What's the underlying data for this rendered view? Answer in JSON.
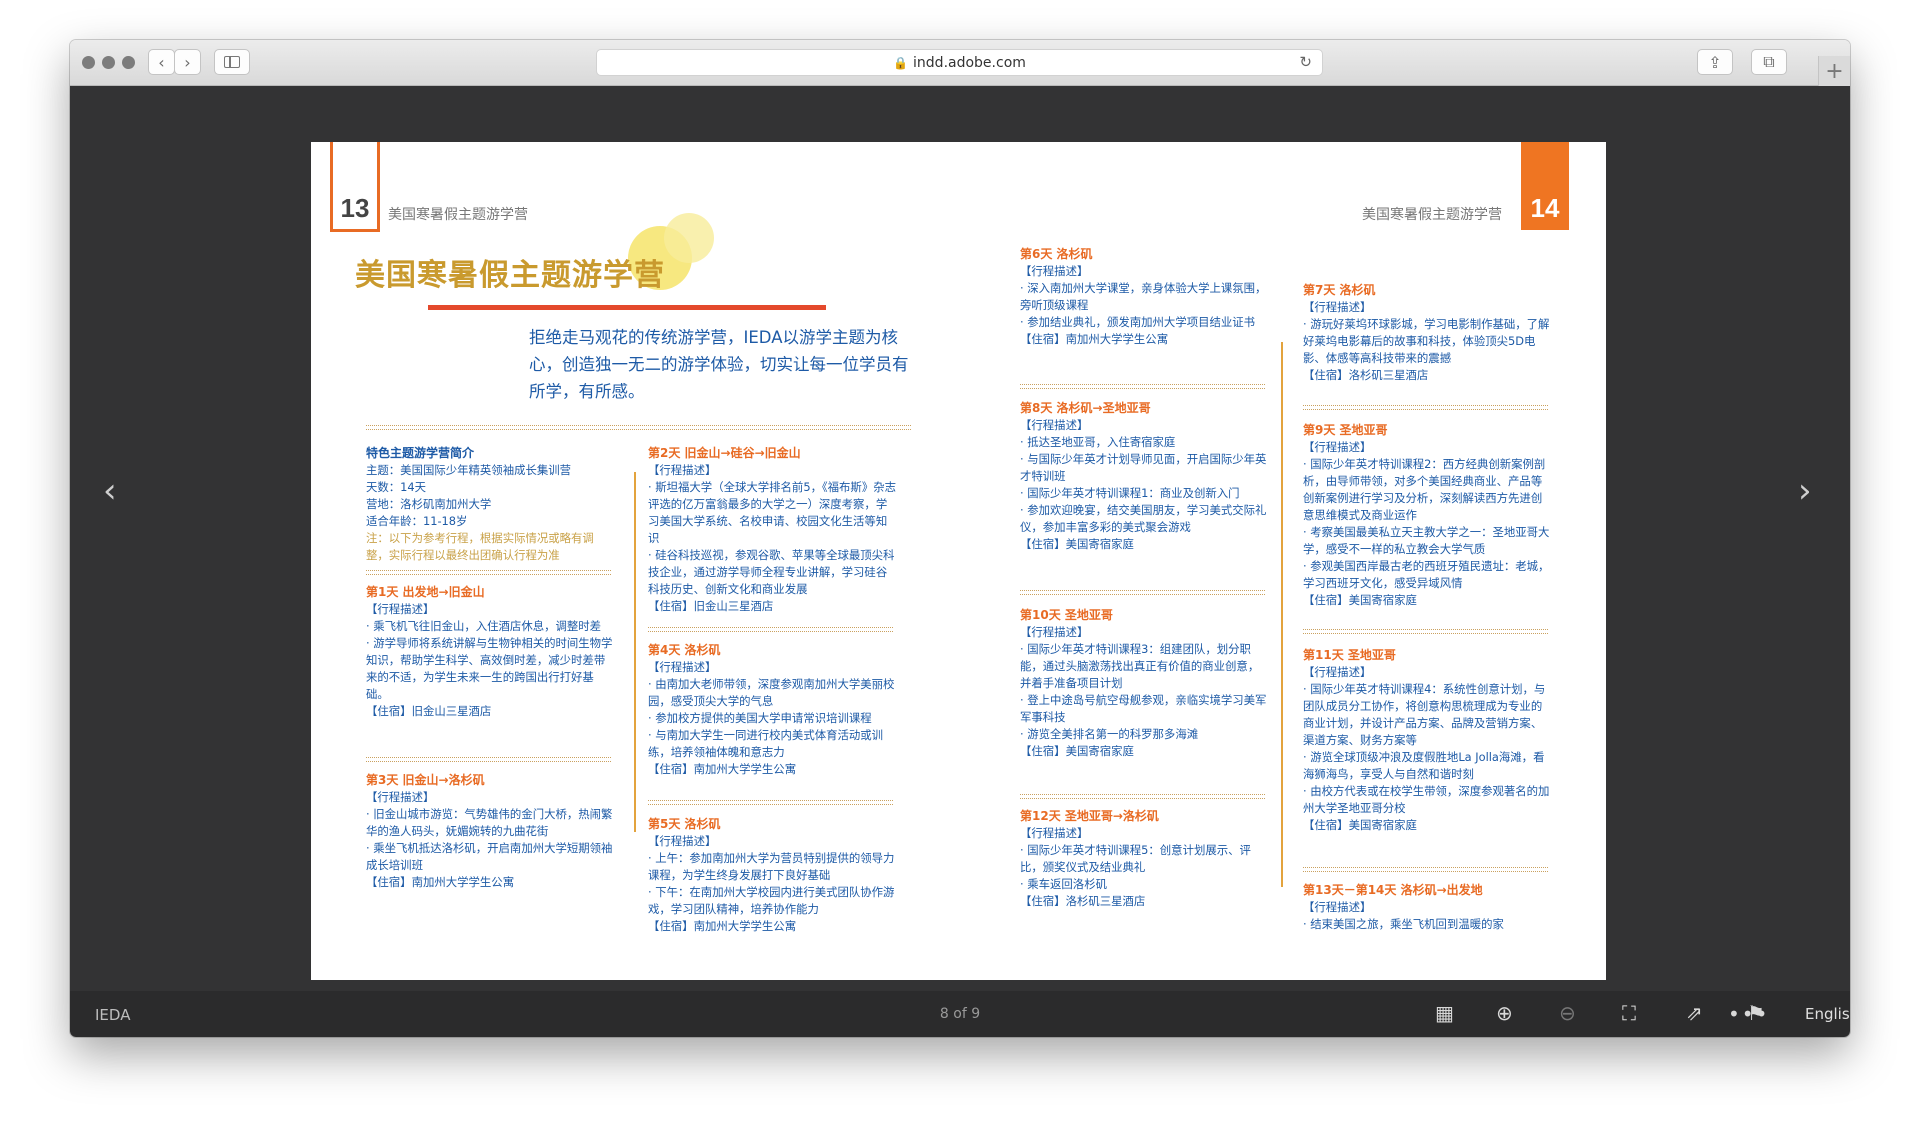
{
  "browser": {
    "url": "indd.adobe.com",
    "icons": [
      "back-icon",
      "forward-icon",
      "sidebar-icon",
      "lock-icon",
      "reload-icon",
      "share-icon",
      "tabs-icon",
      "new-tab-icon"
    ]
  },
  "viewer": {
    "doc_title": "IEDA",
    "page_indicator": "8 of 9",
    "language": "English",
    "colors": {
      "accent_orange": "#ef7522",
      "title_gold": "#c99a2e",
      "text_blue": "#1d5aa6",
      "red_bar": "#e4492c",
      "viewer_bg": "#333334"
    }
  },
  "doc": {
    "page_left": "13",
    "page_right": "14",
    "running_head_left": "美国寒暑假主题游学营",
    "running_head_right": "美国寒暑假主题游学营",
    "title": "美国寒暑假主题游学营",
    "intro": "拒绝走马观花的传统游学营，IEDA以游学主题为核心，创造独一无二的游学体验，切实让每一位学员有所学，有所感。",
    "summary": {
      "heading": "特色主题游学营简介",
      "lines": [
        "主题：美国国际少年精英领袖成长集训营",
        "天数：14天",
        "营地：洛杉矶南加州大学",
        "适合年龄：11-18岁"
      ],
      "note": "注：以下为参考行程，根据实际情况或略有调整，实际行程以最终出团确认行程为准"
    },
    "days": [
      {
        "heading": "第1天 出发地→旧金山",
        "lines": [
          "【行程描述】",
          "· 乘飞机飞往旧金山，入住酒店休息，调整时差",
          "· 游学导师将系统讲解与生物钟相关的时间生物学知识，帮助学生科学、高效倒时差，减少时差带来的不适，为学生未来一生的跨国出行打好基础。",
          "【住宿】旧金山三星酒店"
        ]
      },
      {
        "heading": "第3天 旧金山→洛杉矶",
        "lines": [
          "【行程描述】",
          "· 旧金山城市游览：气势雄伟的金门大桥，热闹繁华的渔人码头，妩媚婉转的九曲花街",
          "· 乘坐飞机抵达洛杉矶，开启南加州大学短期领袖成长培训班",
          "【住宿】南加州大学学生公寓"
        ]
      },
      {
        "heading": "第2天 旧金山→硅谷→旧金山",
        "lines": [
          "【行程描述】",
          "· 斯坦福大学（全球大学排名前5，《福布斯》杂志评选的亿万富翁最多的大学之一）深度考察，学习美国大学系统、名校申请、校园文化生活等知识",
          "· 硅谷科技巡视，参观谷歌、苹果等全球最顶尖科技企业，通过游学导师全程专业讲解，学习硅谷科技历史、创新文化和商业发展",
          "【住宿】旧金山三星酒店"
        ]
      },
      {
        "heading": "第4天 洛杉矶",
        "lines": [
          "【行程描述】",
          "· 由南加大老师带领，深度参观南加州大学美丽校园，感受顶尖大学的气息",
          "· 参加校方提供的美国大学申请常识培训课程",
          "· 与南加大学生一同进行校内美式体育活动或训练，培养领袖体魄和意志力",
          "【住宿】南加州大学学生公寓"
        ]
      },
      {
        "heading": "第5天 洛杉矶",
        "lines": [
          "【行程描述】",
          "· 上午：参加南加州大学为营员特别提供的领导力课程，为学生终身发展打下良好基础",
          "· 下午：在南加州大学校园内进行美式团队协作游戏，学习团队精神，培养协作能力",
          "【住宿】南加州大学学生公寓"
        ]
      },
      {
        "heading": "第6天 洛杉矶",
        "lines": [
          "【行程描述】",
          "· 深入南加州大学课堂，亲身体验大学上课氛围，旁听顶级课程",
          "· 参加结业典礼，颁发南加州大学项目结业证书",
          "【住宿】南加州大学学生公寓"
        ]
      },
      {
        "heading": "第8天 洛杉矶→圣地亚哥",
        "lines": [
          "【行程描述】",
          "· 抵达圣地亚哥，入住寄宿家庭",
          "· 与国际少年英才计划导师见面，开启国际少年英才特训班",
          "· 国际少年英才特训课程1：商业及创新入门",
          "· 参加欢迎晚宴，结交美国朋友，学习美式交际礼仪，参加丰富多彩的美式聚会游戏",
          "【住宿】美国寄宿家庭"
        ]
      },
      {
        "heading": "第10天 圣地亚哥",
        "lines": [
          "【行程描述】",
          "· 国际少年英才特训课程3：组建团队，划分职能，通过头脑激荡找出真正有价值的商业创意，并着手准备项目计划",
          "· 登上中途岛号航空母舰参观，亲临实境学习美军军事科技",
          "· 游览全美排名第一的科罗那多海滩",
          "【住宿】美国寄宿家庭"
        ]
      },
      {
        "heading": "第12天 圣地亚哥→洛杉矶",
        "lines": [
          "【行程描述】",
          "· 国际少年英才特训课程5：创意计划展示、评比，颁奖仪式及结业典礼",
          "· 乘车返回洛杉矶",
          "【住宿】洛杉矶三星酒店"
        ]
      },
      {
        "heading": "第7天 洛杉矶",
        "lines": [
          "【行程描述】",
          "· 游玩好莱坞环球影城，学习电影制作基础，了解好莱坞电影幕后的故事和科技，体验顶尖5D电影、体感等高科技带来的震撼",
          "【住宿】洛杉矶三星酒店"
        ]
      },
      {
        "heading": "第9天 圣地亚哥",
        "lines": [
          "【行程描述】",
          "· 国际少年英才特训课程2：西方经典创新案例剖析，由导师带领，对多个美国经典商业、产品等创新案例进行学习及分析，深刻解读西方先进创意思维模式及商业运作",
          "· 考察美国最美私立天主教大学之一：圣地亚哥大学，感受不一样的私立教会大学气质",
          "· 参观美国西岸最古老的西班牙殖民遗址：老城，学习西班牙文化，感受异域风情",
          "【住宿】美国寄宿家庭"
        ]
      },
      {
        "heading": "第11天 圣地亚哥",
        "lines": [
          "【行程描述】",
          "· 国际少年英才特训课程4：系统性创意计划，与团队成员分工协作，将创意构思梳理成为专业的商业计划，并设计产品方案、品牌及营销方案、渠道方案、财务方案等",
          "· 游览全球顶级冲浪及度假胜地La Jolla海滩，看海狮海鸟，享受人与自然和谐时刻",
          "· 由校方代表或在校学生带领，深度参观著名的加州大学圣地亚哥分校",
          "【住宿】美国寄宿家庭"
        ]
      },
      {
        "heading": "第13天－第14天 洛杉矶→出发地",
        "lines": [
          "【行程描述】",
          "· 结束美国之旅，乘坐飞机回到温暖的家"
        ]
      }
    ]
  }
}
